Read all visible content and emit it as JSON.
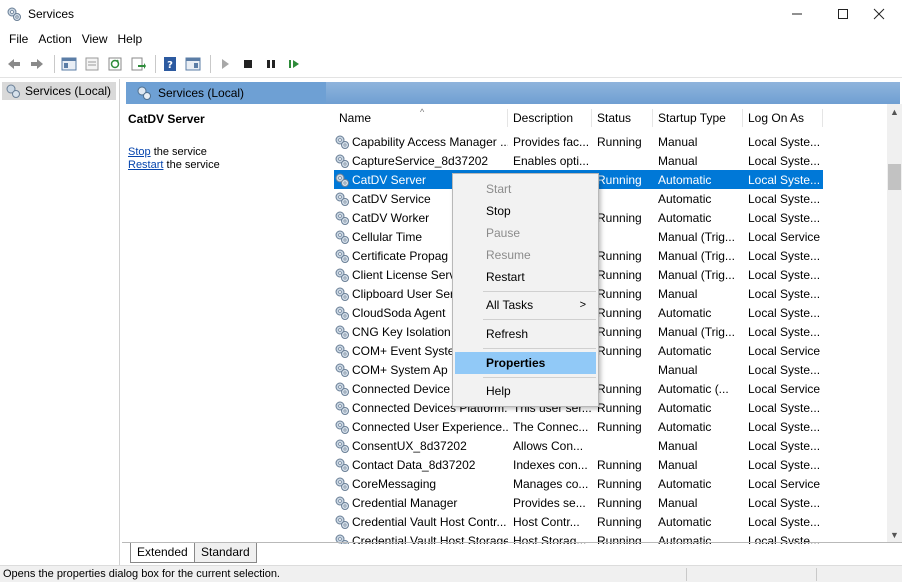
{
  "window": {
    "title": "Services"
  },
  "menu": {
    "items": [
      "File",
      "Action",
      "View",
      "Help"
    ]
  },
  "tree": {
    "root": "Services (Local)"
  },
  "pane": {
    "header": "Services (Local)",
    "selected_service": "CatDV Server",
    "actions": [
      {
        "link": "Stop",
        "rest": " the service"
      },
      {
        "link": "Restart",
        "rest": " the service"
      }
    ]
  },
  "columns": [
    "Name",
    "Description",
    "Status",
    "Startup Type",
    "Log On As"
  ],
  "rows": [
    {
      "name": "Capability Access Manager ...",
      "description": "Provides fac...",
      "status": "Running",
      "startup": "Manual",
      "logon": "Local Syste..."
    },
    {
      "name": "CaptureService_8d37202",
      "description": "Enables opti...",
      "status": "",
      "startup": "Manual",
      "logon": "Local Syste..."
    },
    {
      "name": "CatDV Server",
      "description": "",
      "status": "Running",
      "startup": "Automatic",
      "logon": "Local Syste...",
      "selected": true
    },
    {
      "name": "CatDV Service",
      "description": "",
      "status": "",
      "startup": "Automatic",
      "logon": "Local Syste..."
    },
    {
      "name": "CatDV Worker",
      "description": "",
      "status": "Running",
      "startup": "Automatic",
      "logon": "Local Syste..."
    },
    {
      "name": "Cellular Time",
      "description": "",
      "status": "",
      "startup": "Manual (Trig...",
      "logon": "Local Service"
    },
    {
      "name": "Certificate Propag",
      "description": "",
      "status": "Running",
      "startup": "Manual (Trig...",
      "logon": "Local Syste..."
    },
    {
      "name": "Client License Serv",
      "description": "",
      "status": "Running",
      "startup": "Manual (Trig...",
      "logon": "Local Syste..."
    },
    {
      "name": "Clipboard User Ser",
      "description": "",
      "status": "Running",
      "startup": "Manual",
      "logon": "Local Syste..."
    },
    {
      "name": "CloudSoda Agent",
      "description": "",
      "status": "Running",
      "startup": "Automatic",
      "logon": "Local Syste..."
    },
    {
      "name": "CNG Key Isolation",
      "description": "",
      "status": "Running",
      "startup": "Manual (Trig...",
      "logon": "Local Syste..."
    },
    {
      "name": "COM+ Event Syste",
      "description": "",
      "status": "Running",
      "startup": "Automatic",
      "logon": "Local Service"
    },
    {
      "name": "COM+ System Ap",
      "description": "",
      "status": "",
      "startup": "Manual",
      "logon": "Local Syste..."
    },
    {
      "name": "Connected Device",
      "description": "",
      "status": "Running",
      "startup": "Automatic (...",
      "logon": "Local Service"
    },
    {
      "name": "Connected Devices Platform...",
      "description": "This user ser...",
      "status": "Running",
      "startup": "Automatic",
      "logon": "Local Syste..."
    },
    {
      "name": "Connected User Experience...",
      "description": "The Connec...",
      "status": "Running",
      "startup": "Automatic",
      "logon": "Local Syste..."
    },
    {
      "name": "ConsentUX_8d37202",
      "description": "Allows Con...",
      "status": "",
      "startup": "Manual",
      "logon": "Local Syste..."
    },
    {
      "name": "Contact Data_8d37202",
      "description": "Indexes con...",
      "status": "Running",
      "startup": "Manual",
      "logon": "Local Syste..."
    },
    {
      "name": "CoreMessaging",
      "description": "Manages co...",
      "status": "Running",
      "startup": "Automatic",
      "logon": "Local Service"
    },
    {
      "name": "Credential Manager",
      "description": "Provides se...",
      "status": "Running",
      "startup": "Manual",
      "logon": "Local Syste..."
    },
    {
      "name": "Credential Vault Host Contr...",
      "description": "Host Contr...",
      "status": "Running",
      "startup": "Automatic",
      "logon": "Local Syste..."
    },
    {
      "name": "Credential Vault Host Storage",
      "description": "Host Storag...",
      "status": "Running",
      "startup": "Automatic",
      "logon": "Local Syste..."
    }
  ],
  "context_menu": {
    "start": "Start",
    "stop": "Stop",
    "pause": "Pause",
    "resume": "Resume",
    "restart": "Restart",
    "all_tasks": "All Tasks",
    "all_tasks_arrow": ">",
    "refresh": "Refresh",
    "properties": "Properties",
    "help": "Help"
  },
  "view_tabs": {
    "extended": "Extended",
    "standard": "Standard"
  },
  "status_bar": {
    "text": "Opens the properties dialog box for the current selection."
  },
  "colors": {
    "selection": "#0078d7",
    "menu_highlight": "#91c9f7",
    "header_blue": "#6ea0d4"
  }
}
